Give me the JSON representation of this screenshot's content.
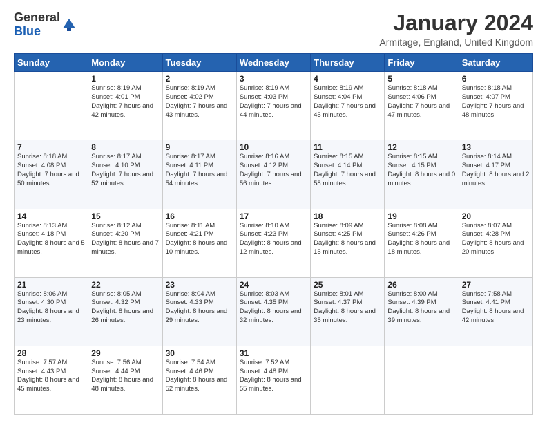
{
  "logo": {
    "general": "General",
    "blue": "Blue"
  },
  "title": "January 2024",
  "subtitle": "Armitage, England, United Kingdom",
  "days_of_week": [
    "Sunday",
    "Monday",
    "Tuesday",
    "Wednesday",
    "Thursday",
    "Friday",
    "Saturday"
  ],
  "weeks": [
    [
      {
        "day": "",
        "sunrise": "",
        "sunset": "",
        "daylight": ""
      },
      {
        "day": "1",
        "sunrise": "Sunrise: 8:19 AM",
        "sunset": "Sunset: 4:01 PM",
        "daylight": "Daylight: 7 hours and 42 minutes."
      },
      {
        "day": "2",
        "sunrise": "Sunrise: 8:19 AM",
        "sunset": "Sunset: 4:02 PM",
        "daylight": "Daylight: 7 hours and 43 minutes."
      },
      {
        "day": "3",
        "sunrise": "Sunrise: 8:19 AM",
        "sunset": "Sunset: 4:03 PM",
        "daylight": "Daylight: 7 hours and 44 minutes."
      },
      {
        "day": "4",
        "sunrise": "Sunrise: 8:19 AM",
        "sunset": "Sunset: 4:04 PM",
        "daylight": "Daylight: 7 hours and 45 minutes."
      },
      {
        "day": "5",
        "sunrise": "Sunrise: 8:18 AM",
        "sunset": "Sunset: 4:06 PM",
        "daylight": "Daylight: 7 hours and 47 minutes."
      },
      {
        "day": "6",
        "sunrise": "Sunrise: 8:18 AM",
        "sunset": "Sunset: 4:07 PM",
        "daylight": "Daylight: 7 hours and 48 minutes."
      }
    ],
    [
      {
        "day": "7",
        "sunrise": "Sunrise: 8:18 AM",
        "sunset": "Sunset: 4:08 PM",
        "daylight": "Daylight: 7 hours and 50 minutes."
      },
      {
        "day": "8",
        "sunrise": "Sunrise: 8:17 AM",
        "sunset": "Sunset: 4:10 PM",
        "daylight": "Daylight: 7 hours and 52 minutes."
      },
      {
        "day": "9",
        "sunrise": "Sunrise: 8:17 AM",
        "sunset": "Sunset: 4:11 PM",
        "daylight": "Daylight: 7 hours and 54 minutes."
      },
      {
        "day": "10",
        "sunrise": "Sunrise: 8:16 AM",
        "sunset": "Sunset: 4:12 PM",
        "daylight": "Daylight: 7 hours and 56 minutes."
      },
      {
        "day": "11",
        "sunrise": "Sunrise: 8:15 AM",
        "sunset": "Sunset: 4:14 PM",
        "daylight": "Daylight: 7 hours and 58 minutes."
      },
      {
        "day": "12",
        "sunrise": "Sunrise: 8:15 AM",
        "sunset": "Sunset: 4:15 PM",
        "daylight": "Daylight: 8 hours and 0 minutes."
      },
      {
        "day": "13",
        "sunrise": "Sunrise: 8:14 AM",
        "sunset": "Sunset: 4:17 PM",
        "daylight": "Daylight: 8 hours and 2 minutes."
      }
    ],
    [
      {
        "day": "14",
        "sunrise": "Sunrise: 8:13 AM",
        "sunset": "Sunset: 4:18 PM",
        "daylight": "Daylight: 8 hours and 5 minutes."
      },
      {
        "day": "15",
        "sunrise": "Sunrise: 8:12 AM",
        "sunset": "Sunset: 4:20 PM",
        "daylight": "Daylight: 8 hours and 7 minutes."
      },
      {
        "day": "16",
        "sunrise": "Sunrise: 8:11 AM",
        "sunset": "Sunset: 4:21 PM",
        "daylight": "Daylight: 8 hours and 10 minutes."
      },
      {
        "day": "17",
        "sunrise": "Sunrise: 8:10 AM",
        "sunset": "Sunset: 4:23 PM",
        "daylight": "Daylight: 8 hours and 12 minutes."
      },
      {
        "day": "18",
        "sunrise": "Sunrise: 8:09 AM",
        "sunset": "Sunset: 4:25 PM",
        "daylight": "Daylight: 8 hours and 15 minutes."
      },
      {
        "day": "19",
        "sunrise": "Sunrise: 8:08 AM",
        "sunset": "Sunset: 4:26 PM",
        "daylight": "Daylight: 8 hours and 18 minutes."
      },
      {
        "day": "20",
        "sunrise": "Sunrise: 8:07 AM",
        "sunset": "Sunset: 4:28 PM",
        "daylight": "Daylight: 8 hours and 20 minutes."
      }
    ],
    [
      {
        "day": "21",
        "sunrise": "Sunrise: 8:06 AM",
        "sunset": "Sunset: 4:30 PM",
        "daylight": "Daylight: 8 hours and 23 minutes."
      },
      {
        "day": "22",
        "sunrise": "Sunrise: 8:05 AM",
        "sunset": "Sunset: 4:32 PM",
        "daylight": "Daylight: 8 hours and 26 minutes."
      },
      {
        "day": "23",
        "sunrise": "Sunrise: 8:04 AM",
        "sunset": "Sunset: 4:33 PM",
        "daylight": "Daylight: 8 hours and 29 minutes."
      },
      {
        "day": "24",
        "sunrise": "Sunrise: 8:03 AM",
        "sunset": "Sunset: 4:35 PM",
        "daylight": "Daylight: 8 hours and 32 minutes."
      },
      {
        "day": "25",
        "sunrise": "Sunrise: 8:01 AM",
        "sunset": "Sunset: 4:37 PM",
        "daylight": "Daylight: 8 hours and 35 minutes."
      },
      {
        "day": "26",
        "sunrise": "Sunrise: 8:00 AM",
        "sunset": "Sunset: 4:39 PM",
        "daylight": "Daylight: 8 hours and 39 minutes."
      },
      {
        "day": "27",
        "sunrise": "Sunrise: 7:58 AM",
        "sunset": "Sunset: 4:41 PM",
        "daylight": "Daylight: 8 hours and 42 minutes."
      }
    ],
    [
      {
        "day": "28",
        "sunrise": "Sunrise: 7:57 AM",
        "sunset": "Sunset: 4:43 PM",
        "daylight": "Daylight: 8 hours and 45 minutes."
      },
      {
        "day": "29",
        "sunrise": "Sunrise: 7:56 AM",
        "sunset": "Sunset: 4:44 PM",
        "daylight": "Daylight: 8 hours and 48 minutes."
      },
      {
        "day": "30",
        "sunrise": "Sunrise: 7:54 AM",
        "sunset": "Sunset: 4:46 PM",
        "daylight": "Daylight: 8 hours and 52 minutes."
      },
      {
        "day": "31",
        "sunrise": "Sunrise: 7:52 AM",
        "sunset": "Sunset: 4:48 PM",
        "daylight": "Daylight: 8 hours and 55 minutes."
      },
      {
        "day": "",
        "sunrise": "",
        "sunset": "",
        "daylight": ""
      },
      {
        "day": "",
        "sunrise": "",
        "sunset": "",
        "daylight": ""
      },
      {
        "day": "",
        "sunrise": "",
        "sunset": "",
        "daylight": ""
      }
    ]
  ]
}
